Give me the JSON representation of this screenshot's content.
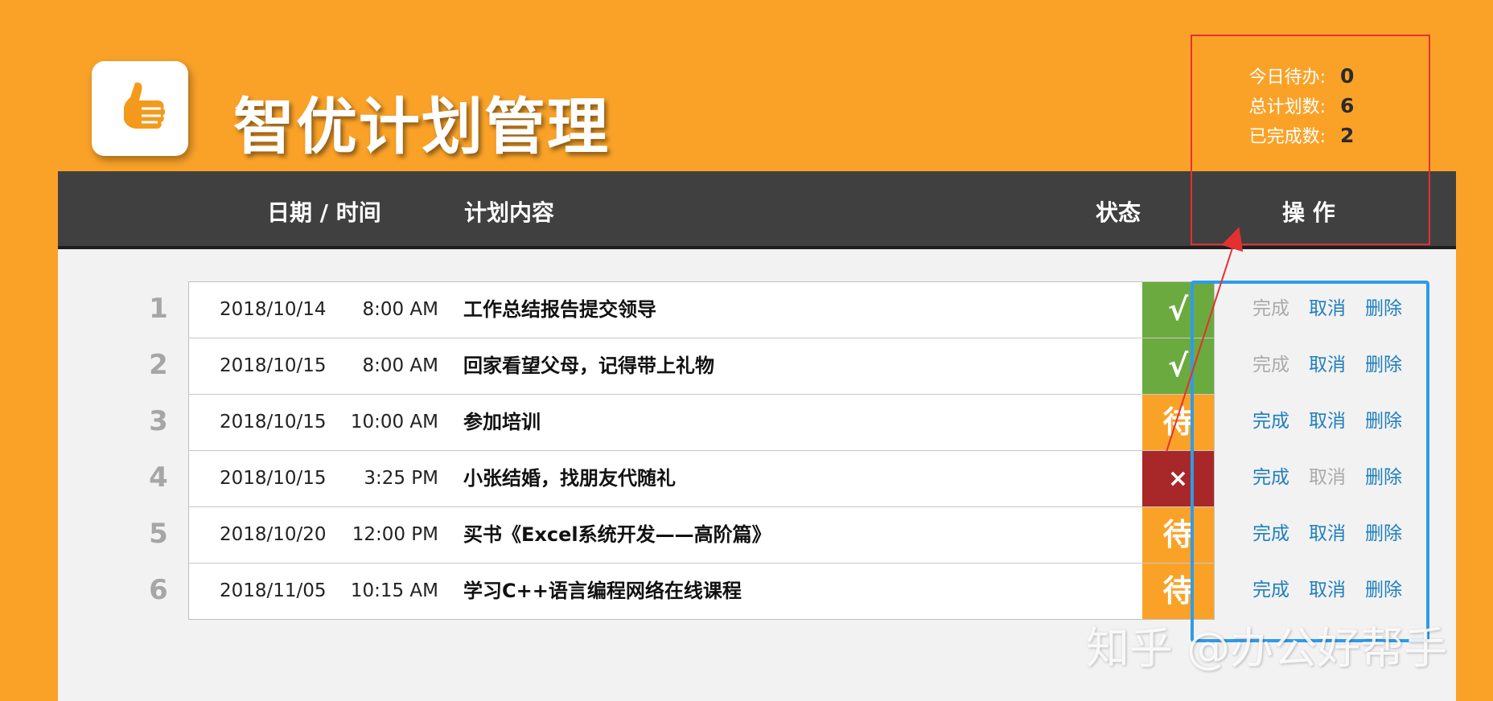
{
  "app": {
    "title": "智优计划管理"
  },
  "stats": [
    {
      "label": "今日待办:",
      "value": "0"
    },
    {
      "label": "总计划数:",
      "value": "6"
    },
    {
      "label": "已完成数:",
      "value": "2"
    }
  ],
  "header": {
    "datetime": "日期 / 时间",
    "content": "计划内容",
    "status": "状态",
    "action": "操 作"
  },
  "status_colors": {
    "done": "#6BAA3E",
    "pending": "#FAA228",
    "cancelled": "#A8282A"
  },
  "rows": [
    {
      "num": "1",
      "date": "2018/10/14",
      "time": "8:00 AM",
      "text": "工作总结报告提交领导",
      "status": "√",
      "state": "done",
      "ops": [
        {
          "label": "完成",
          "enabled": false
        },
        {
          "label": "取消",
          "enabled": true
        },
        {
          "label": "删除",
          "enabled": true
        }
      ]
    },
    {
      "num": "2",
      "date": "2018/10/15",
      "time": "8:00 AM",
      "text": "回家看望父母，记得带上礼物",
      "status": "√",
      "state": "done",
      "ops": [
        {
          "label": "完成",
          "enabled": false
        },
        {
          "label": "取消",
          "enabled": true
        },
        {
          "label": "删除",
          "enabled": true
        }
      ]
    },
    {
      "num": "3",
      "date": "2018/10/15",
      "time": "10:00 AM",
      "text": "参加培训",
      "status": "待",
      "state": "pending",
      "ops": [
        {
          "label": "完成",
          "enabled": true
        },
        {
          "label": "取消",
          "enabled": true
        },
        {
          "label": "删除",
          "enabled": true
        }
      ]
    },
    {
      "num": "4",
      "date": "2018/10/15",
      "time": "3:25 PM",
      "text": "小张结婚，找朋友代随礼",
      "status": "×",
      "state": "cancelled",
      "ops": [
        {
          "label": "完成",
          "enabled": true
        },
        {
          "label": "取消",
          "enabled": false
        },
        {
          "label": "删除",
          "enabled": true
        }
      ]
    },
    {
      "num": "5",
      "date": "2018/10/20",
      "time": "12:00 PM",
      "text": "买书《Excel系统开发——高阶篇》",
      "status": "待",
      "state": "pending",
      "ops": [
        {
          "label": "完成",
          "enabled": true
        },
        {
          "label": "取消",
          "enabled": true
        },
        {
          "label": "删除",
          "enabled": true
        }
      ]
    },
    {
      "num": "6",
      "date": "2018/11/05",
      "time": "10:15 AM",
      "text": "学习C++语言编程网络在线课程",
      "status": "待",
      "state": "pending",
      "ops": [
        {
          "label": "完成",
          "enabled": true
        },
        {
          "label": "取消",
          "enabled": true
        },
        {
          "label": "删除",
          "enabled": true
        }
      ]
    }
  ],
  "watermark": "知乎 @办公好帮手",
  "icons": {
    "logo": "thumbs-up-icon"
  }
}
